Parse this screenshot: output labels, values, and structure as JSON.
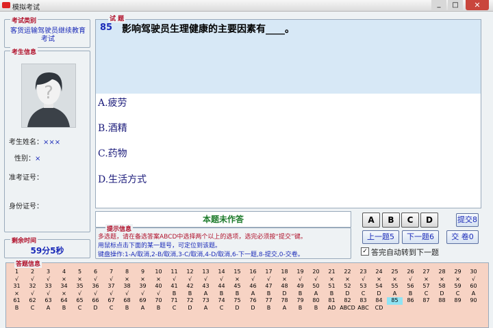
{
  "window": {
    "title": "模拟考试",
    "close": "✕",
    "max": "□",
    "min": "_"
  },
  "exam_type": {
    "label": "考试类别",
    "value": "客货运输驾驶员继续教育考试"
  },
  "student": {
    "label": "考生信息",
    "name_label": "考生姓名：",
    "name_value": "×××",
    "gender_label": "性别：",
    "gender_value": "×",
    "exam_no_label": "准考证号：",
    "id_label": "身份证号："
  },
  "timer": {
    "label": "剩余时间",
    "value": "59分5秒"
  },
  "question": {
    "label": "试 题",
    "number": "85",
    "text": "影响驾驶员生理健康的主要因素有____。",
    "options": [
      "A.疲劳",
      "B.酒精",
      "C.药物",
      "D.生活方式"
    ]
  },
  "status_text": "本题未作答",
  "hints": {
    "label": "提示信息",
    "line1": "多选题，请在备选答案ABCD中选择两个以上的选项，选完必须按“提交”键。",
    "line2": "用鼠标点击下面的某一题号，可定位到该题。",
    "line3": "键盘操作:1-A/取消,2-B/取消,3-C/取消,4-D/取消,6-下一题,8-提交,0-交卷。"
  },
  "answer_buttons": [
    "A",
    "B",
    "C",
    "D"
  ],
  "buttons": {
    "submit": "提交8",
    "prev": "上一题5",
    "next": "下一题6",
    "hand_in": "交 卷0"
  },
  "auto_next": {
    "checked": true,
    "mark": "✓",
    "label": "答完自动转到下一题"
  },
  "answers": {
    "label": "答题信息",
    "current": 85,
    "rows": [
      {
        "nums": [
          "1",
          "2",
          "3",
          "4",
          "5",
          "6",
          "7",
          "8",
          "9",
          "10",
          "11",
          "12",
          "13",
          "14",
          "15",
          "16",
          "17",
          "18",
          "19",
          "20",
          "21",
          "22",
          "23",
          "24",
          "25",
          "26",
          "27",
          "28",
          "29",
          "30"
        ],
        "marks": [
          "√",
          "√",
          "√",
          "×",
          "×",
          "√",
          "√",
          "×",
          "×",
          "×",
          "√",
          "√",
          "√",
          "√",
          "×",
          "√",
          "√",
          "×",
          "√",
          "√",
          "×",
          "×",
          "√",
          "×",
          "×",
          "√",
          "×",
          "×",
          "×",
          "√"
        ]
      },
      {
        "nums": [
          "31",
          "32",
          "33",
          "34",
          "35",
          "36",
          "37",
          "38",
          "39",
          "40",
          "41",
          "42",
          "43",
          "44",
          "45",
          "46",
          "47",
          "48",
          "49",
          "50",
          "51",
          "52",
          "53",
          "54",
          "55",
          "56",
          "57",
          "58",
          "59",
          "60"
        ],
        "marks": [
          "×",
          "√",
          "√",
          "×",
          "√",
          "√",
          "√",
          "√",
          "√",
          "√",
          "B",
          "B",
          "A",
          "B",
          "B",
          "A",
          "B",
          "D",
          "B",
          "A",
          "B",
          "D",
          "C",
          "D",
          "A",
          "B",
          "C",
          "D",
          "C",
          "A"
        ]
      },
      {
        "nums": [
          "61",
          "62",
          "63",
          "64",
          "65",
          "66",
          "67",
          "68",
          "69",
          "70",
          "71",
          "72",
          "73",
          "74",
          "75",
          "76",
          "77",
          "78",
          "79",
          "80",
          "81",
          "82",
          "83",
          "84",
          "85",
          "86",
          "87",
          "88",
          "89",
          "90"
        ],
        "marks": [
          "B",
          "C",
          "A",
          "B",
          "C",
          "D",
          "C",
          "B",
          "A",
          "B",
          "C",
          "D",
          "A",
          "C",
          "D",
          "D",
          "B",
          "A",
          "B",
          "B",
          "AD",
          "ABCD",
          "ABC",
          "CD",
          "",
          "",
          "",
          "",
          "",
          ""
        ]
      }
    ]
  }
}
